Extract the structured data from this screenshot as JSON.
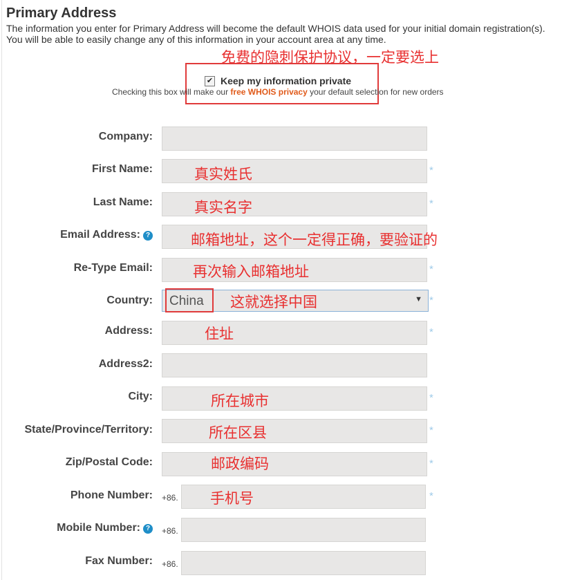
{
  "header": {
    "title": "Primary Address",
    "description": "The information you enter for Primary Address will become the default WHOIS data used for your initial domain registration(s). You will be able to easily change any of this information in your account area at any time."
  },
  "privacy": {
    "checked": true,
    "label": "Keep my information private",
    "note_prefix": "Checking this box will make our ",
    "note_link": "free WHOIS privacy",
    "note_suffix": " your default selection for new orders"
  },
  "annotations": {
    "privacy": "免费的隐刺保护协议，一定要选上",
    "first_name": "真实姓氏",
    "last_name": "真实名字",
    "email": "邮箱地址，这个一定得正确，要验证的",
    "retype_email": "再次输入邮箱地址",
    "country": "这就选择中国",
    "address": "住址",
    "city": "所在城市",
    "state": "所在区县",
    "zip": "邮政编码",
    "phone": "手机号"
  },
  "form": {
    "company_label": "Company:",
    "first_name_label": "First Name:",
    "last_name_label": "Last Name:",
    "email_label": "Email Address:",
    "retype_email_label": "Re-Type Email:",
    "country_label": "Country:",
    "country_value": "China",
    "address_label": "Address:",
    "address2_label": "Address2:",
    "city_label": "City:",
    "state_label": "State/Province/Territory:",
    "zip_label": "Zip/Postal Code:",
    "phone_label": "Phone Number:",
    "mobile_label": "Mobile Number:",
    "fax_label": "Fax Number:",
    "phone_prefix": "+86.",
    "help_glyph": "?",
    "required_glyph": "*",
    "checkbox_glyph": "✔",
    "select_arrow_glyph": "▼"
  },
  "colors": {
    "annotation": "#e83030",
    "link": "#e05a1a",
    "help": "#1f8ec8",
    "required": "#9fcbe8"
  }
}
